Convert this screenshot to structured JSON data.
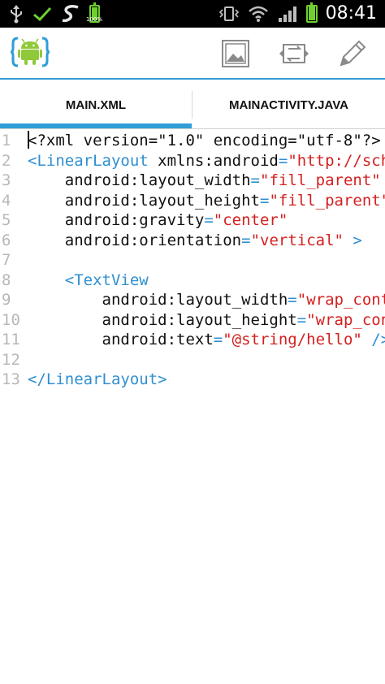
{
  "status_bar": {
    "time": "08:41",
    "battery_text": "100%",
    "icons": [
      "usb-icon",
      "check-icon",
      "app-s-icon",
      "battery-icon",
      "vibrate-icon",
      "wifi-icon",
      "signal-icon"
    ]
  },
  "action_bar": {
    "icons": [
      "android-logo-icon",
      "image-icon",
      "swap-icon",
      "pencil-icon"
    ]
  },
  "tabs": [
    {
      "label": "MAIN.XML",
      "selected": true
    },
    {
      "label": "MAINACTIVITY.JAVA",
      "selected": false
    }
  ],
  "colors": {
    "accent": "#2f9ed6",
    "tag": "#2f8fd0",
    "string": "#d42020",
    "line_number": "#b8b8b8",
    "status_green": "#6fcf2f"
  },
  "editor": {
    "lines": [
      {
        "n": "1",
        "tokens": [
          {
            "t": "<?xml version=\"1.0\" encoding=\"utf-8\"?>",
            "c": "pl"
          }
        ]
      },
      {
        "n": "2",
        "tokens": [
          {
            "t": "<LinearLayout",
            "c": "tag"
          },
          {
            "t": " xmlns:android",
            "c": "attr"
          },
          {
            "t": "=",
            "c": "eq"
          },
          {
            "t": "\"http://sche",
            "c": "str"
          }
        ]
      },
      {
        "n": "3",
        "tokens": [
          {
            "t": "    android:layout_width",
            "c": "attr"
          },
          {
            "t": "=",
            "c": "eq"
          },
          {
            "t": "\"fill_parent\"",
            "c": "str"
          }
        ]
      },
      {
        "n": "4",
        "tokens": [
          {
            "t": "    android:layout_height",
            "c": "attr"
          },
          {
            "t": "=",
            "c": "eq"
          },
          {
            "t": "\"fill_parent\"",
            "c": "str"
          }
        ]
      },
      {
        "n": "5",
        "tokens": [
          {
            "t": "    android:gravity",
            "c": "attr"
          },
          {
            "t": "=",
            "c": "eq"
          },
          {
            "t": "\"center\"",
            "c": "str"
          }
        ]
      },
      {
        "n": "6",
        "tokens": [
          {
            "t": "    android:orientation",
            "c": "attr"
          },
          {
            "t": "=",
            "c": "eq"
          },
          {
            "t": "\"vertical\"",
            "c": "str"
          },
          {
            "t": " >",
            "c": "tag"
          }
        ]
      },
      {
        "n": "7",
        "tokens": []
      },
      {
        "n": "8",
        "tokens": [
          {
            "t": "    <TextView",
            "c": "tag"
          }
        ]
      },
      {
        "n": "9",
        "tokens": [
          {
            "t": "        android:layout_width",
            "c": "attr"
          },
          {
            "t": "=",
            "c": "eq"
          },
          {
            "t": "\"wrap_conte",
            "c": "str"
          }
        ]
      },
      {
        "n": "10",
        "tokens": [
          {
            "t": "        android:layout_height",
            "c": "attr"
          },
          {
            "t": "=",
            "c": "eq"
          },
          {
            "t": "\"wrap_cont",
            "c": "str"
          }
        ]
      },
      {
        "n": "11",
        "tokens": [
          {
            "t": "        android:text",
            "c": "attr"
          },
          {
            "t": "=",
            "c": "eq"
          },
          {
            "t": "\"@string/hello\"",
            "c": "str"
          },
          {
            "t": " />",
            "c": "tag"
          }
        ]
      },
      {
        "n": "12",
        "tokens": []
      },
      {
        "n": "13",
        "tokens": [
          {
            "t": "</LinearLayout>",
            "c": "tag"
          }
        ]
      }
    ]
  }
}
